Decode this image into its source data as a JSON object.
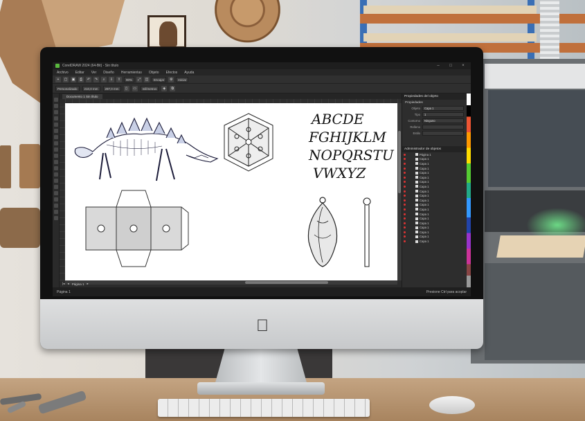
{
  "app": {
    "title": "CorelDRAW 2024 (64-Bit) - Sin título",
    "menu": [
      "Archivo",
      "Editar",
      "Ver",
      "Diseño",
      "Herramientas",
      "Objeto",
      "Efectos",
      "Ayuda"
    ],
    "toolbar": {
      "zoom": "90%",
      "snap_label": "Encajar",
      "launch_label": "Iniciar"
    },
    "propbar": {
      "preset": "Personalizado",
      "x": "210,0 mm",
      "y": "297,0 mm",
      "units": "milímetros"
    },
    "document_tab": "Documento 1 Sin título",
    "page_label": "Página 1",
    "status": {
      "left": "Página 1",
      "right": "Presione Ctrl para acoplar"
    },
    "docker_title": "Propiedades del objeto",
    "docker_sub": "Propiedades",
    "props": [
      {
        "label": "Objeto",
        "value": "Capa 1"
      },
      {
        "label": "Tipo",
        "value": "1"
      },
      {
        "label": "Contorno",
        "value": "Ninguno"
      },
      {
        "label": "Relleno",
        "value": ""
      },
      {
        "label": "Estilo",
        "value": ""
      }
    ],
    "objects_header": "Administrador de objetos",
    "objects": [
      "Página 1",
      "Capa 1",
      "Capa 1",
      "Capa 1",
      "Capa 1",
      "Capa 1",
      "Capa 1",
      "Capa 1",
      "Capa 1",
      "Capa 1",
      "Capa 1",
      "Capa 1",
      "Capa 1",
      "Capa 1",
      "Capa 1",
      "Capa 1",
      "Capa 1",
      "Capa 1",
      "Capa 1",
      "Capa 1"
    ]
  },
  "canvas": {
    "font_sample": [
      "ABCDE",
      "FGHIJKLM",
      "NOPQRSTU",
      "VWXYZ"
    ]
  },
  "icons": {
    "apple": "apple-logo-icon",
    "app_logo": "app-logo-icon"
  },
  "colors": {
    "accent": "#5ab93e",
    "dark_ui": "#2b2b2b",
    "aluminium": "#d3d4d6"
  }
}
